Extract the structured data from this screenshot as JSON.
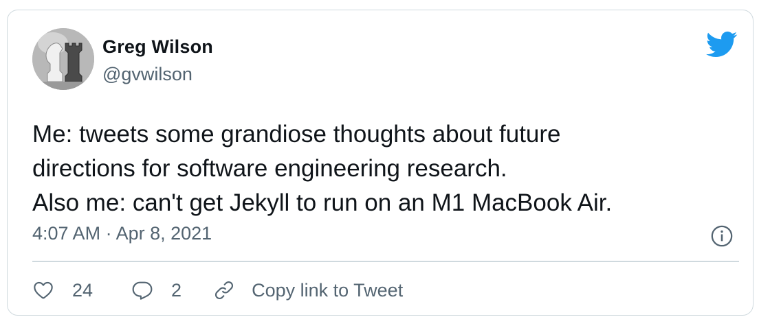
{
  "author": {
    "display_name": "Greg Wilson",
    "handle": "@gvwilson",
    "avatar_icon": "chess-pieces-avatar"
  },
  "brand": {
    "icon": "twitter-bird-icon",
    "color": "#1d9bf0"
  },
  "tweet": {
    "lines": [
      "Me: tweets some grandiose thoughts about future",
      "directions for software engineering research.",
      "Also me: can't get Jekyll to run on an M1 MacBook Air."
    ],
    "timestamp": "4:07 AM · Apr 8, 2021"
  },
  "actions": {
    "likes": {
      "icon": "heart-icon",
      "count": "24"
    },
    "replies": {
      "icon": "reply-bubble-icon",
      "count": "2"
    },
    "copy_link": {
      "icon": "link-icon",
      "label": "Copy link to Tweet"
    },
    "info_icon": "info-icon"
  },
  "colors": {
    "text_primary": "#0f1419",
    "text_secondary": "#536471",
    "border": "#cfd9de"
  }
}
